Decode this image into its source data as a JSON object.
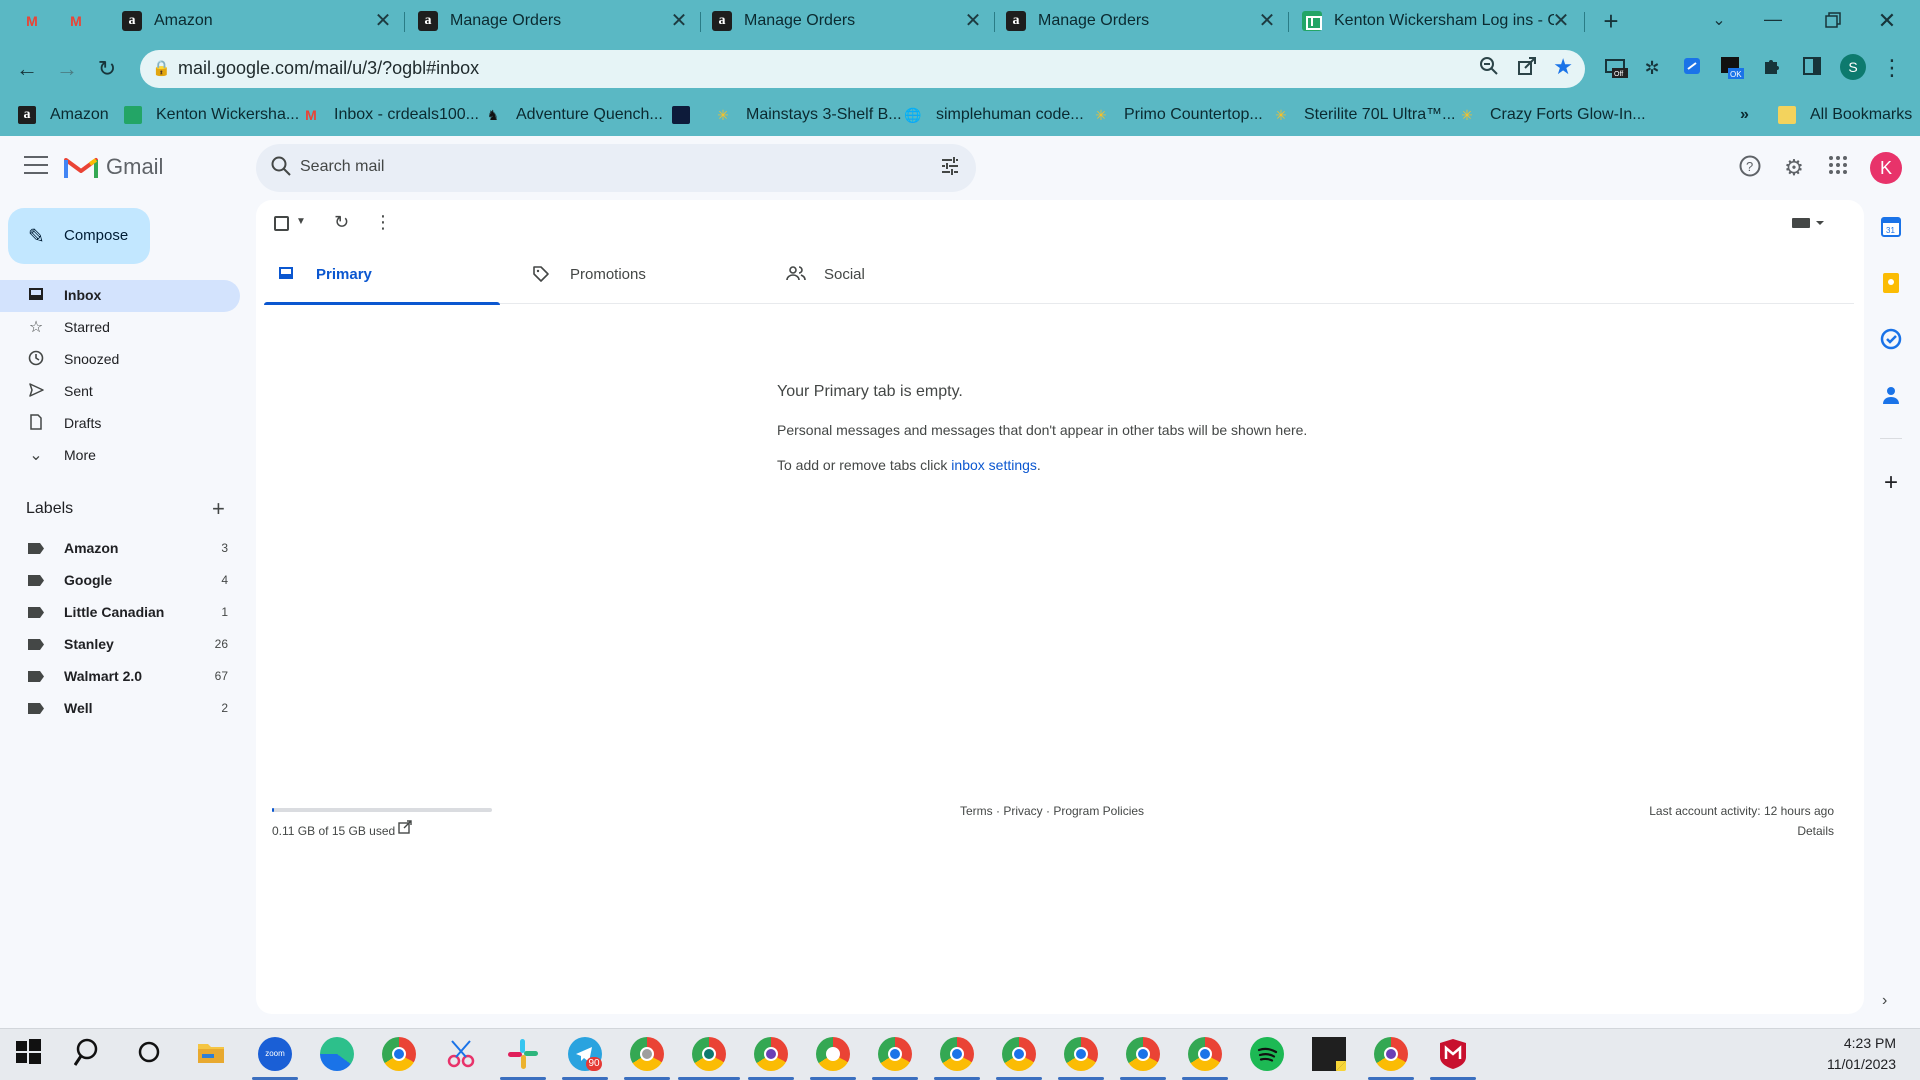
{
  "browser": {
    "tabs": [
      {
        "title": "",
        "icon": "gmail-icon"
      },
      {
        "title": "",
        "icon": "gmail-icon"
      },
      {
        "title": "Amazon",
        "icon": "amazon-icon"
      },
      {
        "title": "Manage Orders",
        "icon": "amazon-icon"
      },
      {
        "title": "Manage Orders",
        "icon": "amazon-icon"
      },
      {
        "title": "Manage Orders",
        "icon": "amazon-icon"
      },
      {
        "title": "Kenton Wickersham Log ins - G",
        "icon": "sheets-icon"
      }
    ],
    "url": "mail.google.com/mail/u/3/?ogbl#inbox",
    "profile_initial": "S",
    "bookmarks": [
      {
        "label": "Amazon",
        "icon": "amazon-icon"
      },
      {
        "label": "Kenton Wickersha...",
        "icon": "sheets-icon"
      },
      {
        "label": "Inbox - crdeals100...",
        "icon": "gmail-icon"
      },
      {
        "label": "Adventure Quench...",
        "icon": "horse-icon"
      },
      {
        "label": "",
        "icon": "dark-site-icon"
      },
      {
        "label": "Mainstays 3-Shelf B...",
        "icon": "walmart-icon"
      },
      {
        "label": "simplehuman code...",
        "icon": "globe-icon"
      },
      {
        "label": "Primo Countertop...",
        "icon": "walmart-icon"
      },
      {
        "label": "Sterilite 70L Ultra™...",
        "icon": "walmart-icon"
      },
      {
        "label": "Crazy Forts Glow-In...",
        "icon": "walmart-icon"
      }
    ],
    "more_bookmarks": "»",
    "all_bookmarks": "All Bookmarks"
  },
  "gmail": {
    "brand": "Gmail",
    "search_placeholder": "Search mail",
    "account_initial": "K",
    "compose_label": "Compose",
    "nav": [
      {
        "label": "Inbox",
        "icon": "inbox-icon",
        "active": true
      },
      {
        "label": "Starred",
        "icon": "star-icon"
      },
      {
        "label": "Snoozed",
        "icon": "clock-icon"
      },
      {
        "label": "Sent",
        "icon": "send-icon"
      },
      {
        "label": "Drafts",
        "icon": "draft-icon"
      },
      {
        "label": "More",
        "icon": "chevron-down-icon"
      }
    ],
    "labels_heading": "Labels",
    "labels": [
      {
        "name": "Amazon",
        "count": "3"
      },
      {
        "name": "Google",
        "count": "4"
      },
      {
        "name": "Little Canadian",
        "count": "1"
      },
      {
        "name": "Stanley",
        "count": "26"
      },
      {
        "name": "Walmart 2.0",
        "count": "67"
      },
      {
        "name": "Well",
        "count": "2"
      }
    ],
    "category_tabs": [
      {
        "label": "Primary",
        "icon": "inbox-icon",
        "active": true
      },
      {
        "label": "Promotions",
        "icon": "tag-icon"
      },
      {
        "label": "Social",
        "icon": "people-icon"
      }
    ],
    "empty": {
      "title": "Your Primary tab is empty.",
      "message": "Personal messages and messages that don't appear in other tabs will be shown here.",
      "tabs_prefix": "To add or remove tabs click ",
      "tabs_link": "inbox settings",
      "tabs_suffix": "."
    },
    "footer": {
      "storage": "0.11 GB of 15 GB used",
      "storage_fraction": 0.0073,
      "links": "Terms · Privacy · Program Policies",
      "last_activity": "Last account activity: 12 hours ago",
      "details": "Details"
    }
  },
  "taskbar": {
    "time": "4:23 PM",
    "date": "11/01/2023",
    "badge": "90"
  },
  "colors": {
    "browser_chrome": "#5ab8c4",
    "gmail_bg": "#f6f8fc",
    "compose_bg": "#c2e7ff",
    "active_nav": "#d3e3fd",
    "primary_blue": "#0b57d0",
    "avatar": "#e8336a"
  }
}
